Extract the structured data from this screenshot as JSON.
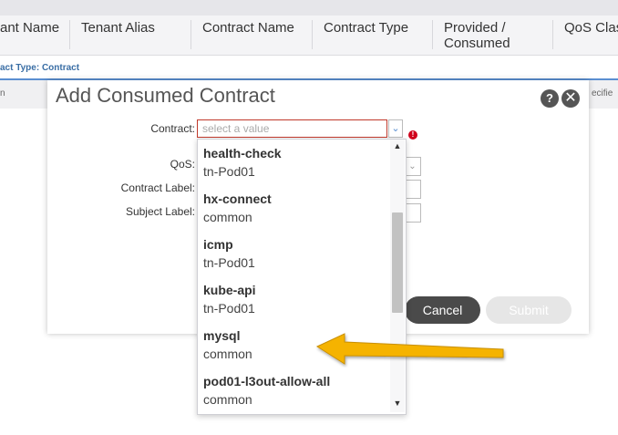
{
  "grid": {
    "columns": [
      "ant Name",
      "Tenant Alias",
      "Contract Name",
      "Contract Type",
      "Provided / Consumed",
      "QoS Clas"
    ],
    "group_label": "act Type: Contract",
    "row1_left": "n",
    "row1_right": "ecifie"
  },
  "dialog": {
    "title": "Add Consumed Contract",
    "help": "?",
    "close": "✕",
    "labels": {
      "contract": "Contract:",
      "qos": "QoS:",
      "contract_label": "Contract Label:",
      "subject_label": "Subject Label:"
    },
    "contract_placeholder": "select a value",
    "error_mark": "!",
    "cancel": "Cancel",
    "submit": "Submit"
  },
  "dropdown": {
    "items": [
      {
        "name": "health-check",
        "tenant": "tn-Pod01"
      },
      {
        "name": "hx-connect",
        "tenant": "common"
      },
      {
        "name": "icmp",
        "tenant": "tn-Pod01"
      },
      {
        "name": "kube-api",
        "tenant": "tn-Pod01"
      },
      {
        "name": "mysql",
        "tenant": "common"
      },
      {
        "name": "pod01-l3out-allow-all",
        "tenant": "common"
      }
    ]
  },
  "colors": {
    "accent": "#5b8fd1",
    "error": "#d0021b",
    "annotation_arrow": "#f5b301"
  }
}
